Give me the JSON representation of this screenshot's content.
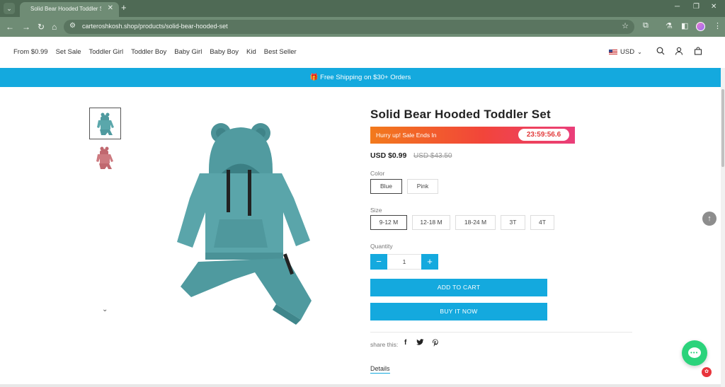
{
  "browser": {
    "tab_title": "Solid Bear Hooded Toddler Set",
    "url": "carteroshkosh.shop/products/solid-bear-hooded-set"
  },
  "nav": {
    "items": [
      "From $0.99",
      "Set Sale",
      "Toddler Girl",
      "Toddler Boy",
      "Baby Girl",
      "Baby Boy",
      "Kid",
      "Best Seller"
    ],
    "currency": "USD"
  },
  "banner": {
    "text": "🎁 Free Shipping on $30+ Orders"
  },
  "product": {
    "title": "Solid Bear Hooded Toddler Set",
    "sale_text": "Hurry up! Sale Ends In",
    "timer": "23:59:56.6",
    "price": "USD $0.99",
    "compare_price": "USD $43.50",
    "color_label": "Color",
    "colors": [
      "Blue",
      "Pink"
    ],
    "selected_color": "Blue",
    "size_label": "Size",
    "sizes": [
      "9-12 M",
      "12-18 M",
      "18-24 M",
      "3T",
      "4T"
    ],
    "selected_size": "9-12 M",
    "quantity_label": "Quantity",
    "quantity": "1",
    "add_to_cart": "ADD TO CART",
    "buy_now": "BUY IT NOW",
    "share_label": "share this:",
    "details_label": "Details"
  },
  "colors": {
    "accent": "#14a9de",
    "chat": "#2bd37b",
    "chrome": "#6f8c75",
    "tab_strip": "#4f6a55"
  }
}
